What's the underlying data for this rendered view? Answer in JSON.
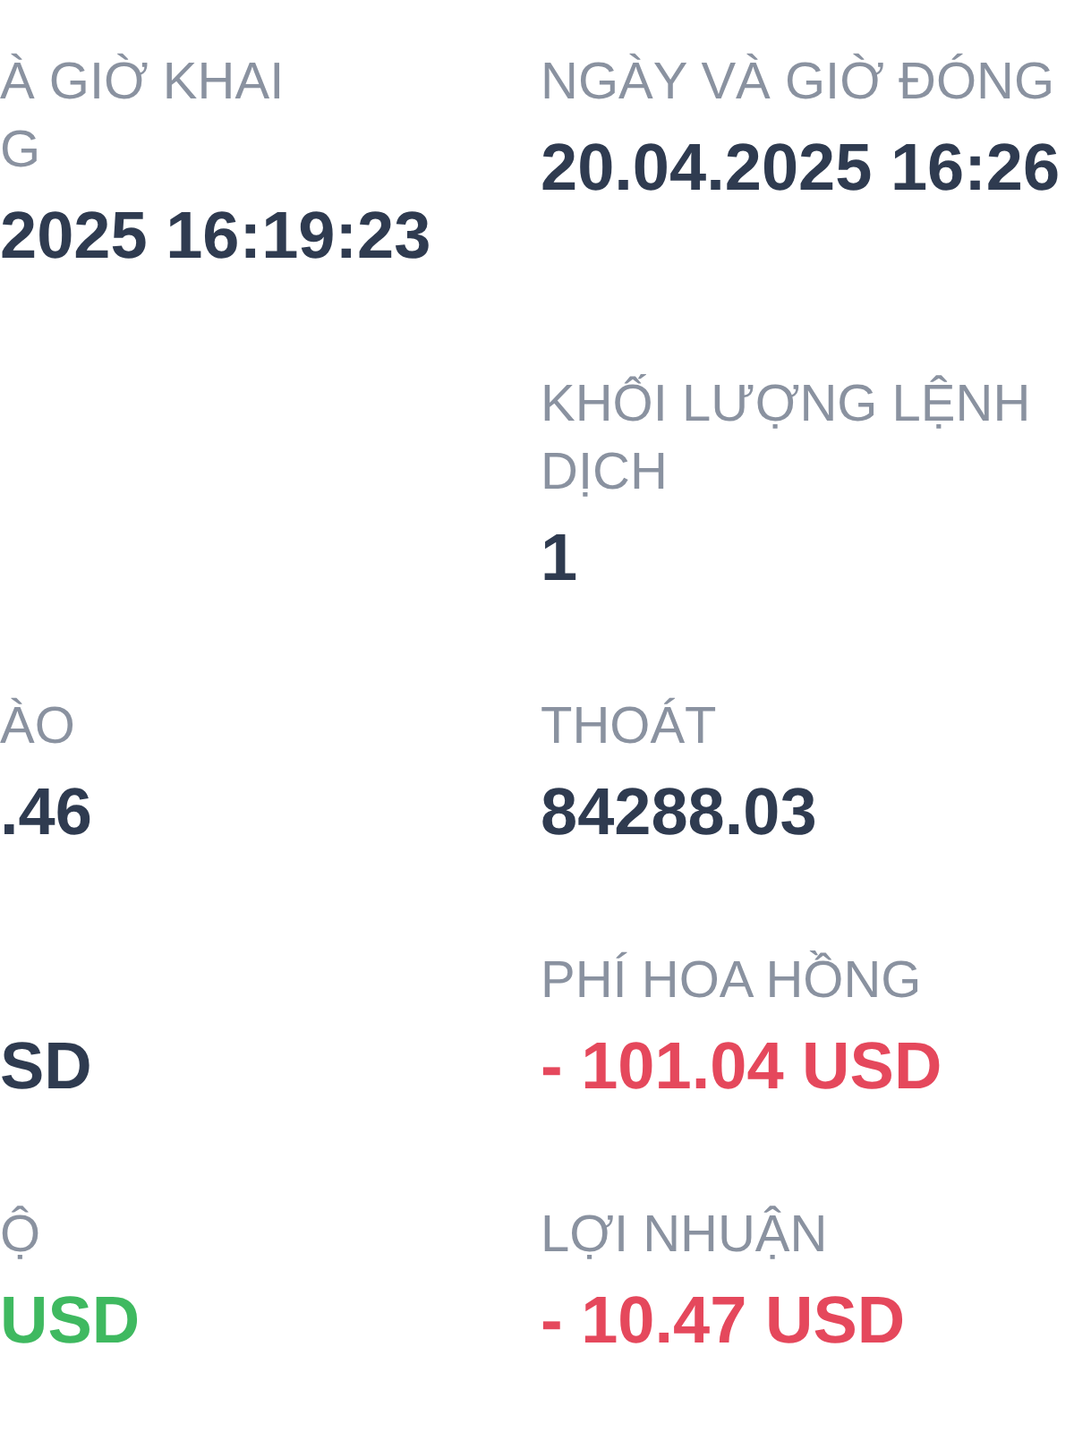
{
  "rows": [
    {
      "left": {
        "label": "À GIỜ KHAI\nG",
        "value": "2025 16:19:23",
        "color": "#2f3b50"
      },
      "right": {
        "label": "NGÀY VÀ GIỜ ĐÓNG",
        "value": "20.04.2025 16:26",
        "color": "#2f3b50"
      }
    },
    {
      "right": {
        "label": "KHỐI LƯỢNG LỆNH\nDỊCH",
        "value": "1",
        "color": "#2f3b50"
      }
    },
    {
      "left": {
        "label": "ÀO",
        "value": ".46",
        "color": "#2f3b50"
      },
      "right": {
        "label": "THOÁT",
        "value": "84288.03",
        "color": "#2f3b50"
      }
    },
    {
      "left": {
        "value": "SD",
        "color": "#2f3b50"
      },
      "right": {
        "label": "PHÍ HOA HỒNG",
        "value": "- 101.04 USD",
        "color": "#e5485c"
      }
    },
    {
      "left": {
        "label": "Ộ",
        "value": "USD",
        "color": "#3fb960"
      },
      "right": {
        "label": "LỢI NHUẬN",
        "value": "- 10.47 USD",
        "color": "#e5485c"
      }
    }
  ]
}
